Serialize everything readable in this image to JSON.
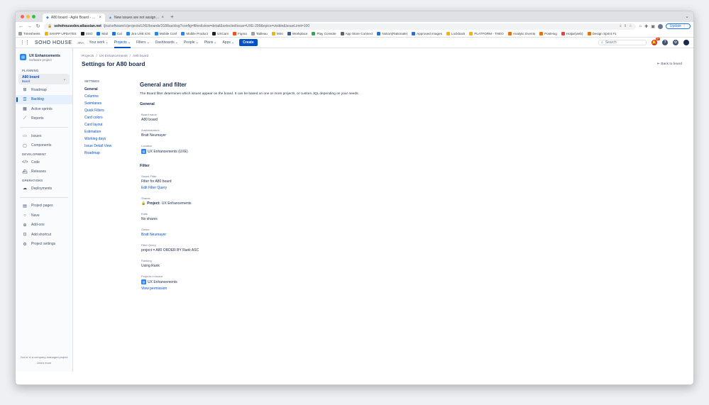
{
  "browser": {
    "tabs": [
      {
        "title": "A80 board - Agile Board - JIRA",
        "active": true
      },
      {
        "title": "New issues are not assigned t",
        "active": false
      }
    ],
    "url_host": "sohohousedev.atlassian.net",
    "url_path": "/jira/software/c/projects/UXE/boards/318/backlog?config=filter&view=detail&selectedIssue=UXE-299&epics=visible&issueLimit=100",
    "update_label": "Update",
    "bookmarks": [
      {
        "label": "Timesheets",
        "color": "#9e9e9e"
      },
      {
        "label": "SHAPP UPDATES",
        "color": "#f4b400"
      },
      {
        "label": "SSO",
        "color": "#202124"
      },
      {
        "label": "Mail",
        "color": "#1a73e8"
      },
      {
        "label": "Cal",
        "color": "#1a73e8"
      },
      {
        "label": "Jira UXE iOS",
        "color": "#2684ff"
      },
      {
        "label": "Mobile Conf",
        "color": "#2684ff"
      },
      {
        "label": "Mobile Product",
        "color": "#2684ff"
      },
      {
        "label": "UXCam",
        "color": "#202124"
      },
      {
        "label": "Figma",
        "color": "#f24e1e"
      },
      {
        "label": "Tableau",
        "color": "#9e9e9e"
      },
      {
        "label": "Miro",
        "color": "#f4b400"
      },
      {
        "label": "Workplace",
        "color": "#3b5998"
      },
      {
        "label": "Play Console",
        "color": "#34a853"
      },
      {
        "label": "App Store Connect",
        "color": "#5f6368"
      },
      {
        "label": "Notion(Rationale)",
        "color": "#1a73e8"
      },
      {
        "label": "Approved images",
        "color": "#3367d6"
      },
      {
        "label": "Lockback",
        "color": "#f4b400"
      },
      {
        "label": "PLATFORM - THEO",
        "color": "#f4b400"
      },
      {
        "label": "Analytic Events",
        "color": "#e8710a"
      },
      {
        "label": "PostHog",
        "color": "#e8710a"
      },
      {
        "label": "Hotjar(web)",
        "color": "#ea4335"
      },
      {
        "label": "Design Sprint #1",
        "color": "#e8710a"
      }
    ]
  },
  "jira_nav": {
    "brand": "SOHO HOUSE",
    "brand_sub": "JIRA",
    "items": [
      {
        "label": "Your work",
        "active": false
      },
      {
        "label": "Projects",
        "active": true
      },
      {
        "label": "Filters",
        "active": false
      },
      {
        "label": "Dashboards",
        "active": false
      },
      {
        "label": "People",
        "active": false
      },
      {
        "label": "Plans",
        "active": false
      },
      {
        "label": "Apps",
        "active": false
      }
    ],
    "create_label": "Create",
    "search_placeholder": "Search",
    "notif_count": "9+"
  },
  "sidebar": {
    "project_name": "UX Enhancements",
    "project_type": "Software project",
    "planning_heading": "PLANNING",
    "board_name": "A80 board",
    "board_sub": "Board",
    "planning_items": [
      {
        "label": "Roadmap",
        "icon": "roadmap-icon"
      },
      {
        "label": "Backlog",
        "icon": "backlog-icon"
      },
      {
        "label": "Active sprints",
        "icon": "active-sprints-icon"
      },
      {
        "label": "Reports",
        "icon": "reports-icon"
      }
    ],
    "other_items": [
      {
        "label": "Issues",
        "icon": "issues-icon"
      },
      {
        "label": "Components",
        "icon": "components-icon"
      }
    ],
    "development_heading": "DEVELOPMENT",
    "development_items": [
      {
        "label": "Code",
        "icon": "code-icon"
      },
      {
        "label": "Releases",
        "icon": "releases-icon"
      }
    ],
    "operations_heading": "OPERATIONS",
    "operations_items": [
      {
        "label": "Deployments",
        "icon": "deployments-icon"
      }
    ],
    "bottom_items": [
      {
        "label": "Project pages",
        "icon": "pages-icon"
      },
      {
        "label": "Nave",
        "icon": "circle-icon"
      },
      {
        "label": "Add-ons",
        "icon": "addons-icon"
      },
      {
        "label": "Add shortcut",
        "icon": "shortcut-icon"
      },
      {
        "label": "Project settings",
        "icon": "settings-icon"
      }
    ],
    "managed_text": "You're in a company-managed project",
    "learn_more": "Learn more"
  },
  "breadcrumbs": [
    "Projects",
    "UX Enhancements",
    "A80 board"
  ],
  "page_title": "Settings for A80 board",
  "back_to_board": "Back to board",
  "settings_nav": {
    "heading": "SETTINGS",
    "items": [
      "General",
      "Columns",
      "Swimlanes",
      "Quick Filters",
      "Card colors",
      "Card layout",
      "Estimation",
      "Working days",
      "Issue Detail View",
      "Roadmap"
    ],
    "current": "General"
  },
  "content": {
    "title": "General and filter",
    "description": "The Board filter determines which issues appear on the board. It can be based on one or more projects, or custom JQL depending on your needs.",
    "general_heading": "General",
    "board_name_label": "Board name",
    "board_name_value": "A80 board",
    "administrators_label": "Administrators",
    "administrators_value": "Bratt Neumayer",
    "location_label": "Location",
    "location_value": "UX Enhancements (UXE)",
    "filter_heading": "Filter",
    "saved_filter_label": "Saved Filter",
    "saved_filter_value": "Filter for A80 board",
    "edit_filter_query": "Edit Filter Query",
    "shares_label": "Shares",
    "shares_prefix": "Project:",
    "shares_value": "UX Enhancements",
    "edits_label": "Edits",
    "edits_value": "No shares",
    "owner_label": "Owner",
    "owner_value": "Bratt Neumayer",
    "filter_query_label": "Filter Query",
    "filter_query_value": "project = A80 ORDER BY Rank ASC",
    "ranking_label": "Ranking",
    "ranking_value": "Using Rank",
    "projects_in_board_label": "Projects in board",
    "projects_in_board_value": "UX Enhancements",
    "view_permission": "View permission"
  }
}
